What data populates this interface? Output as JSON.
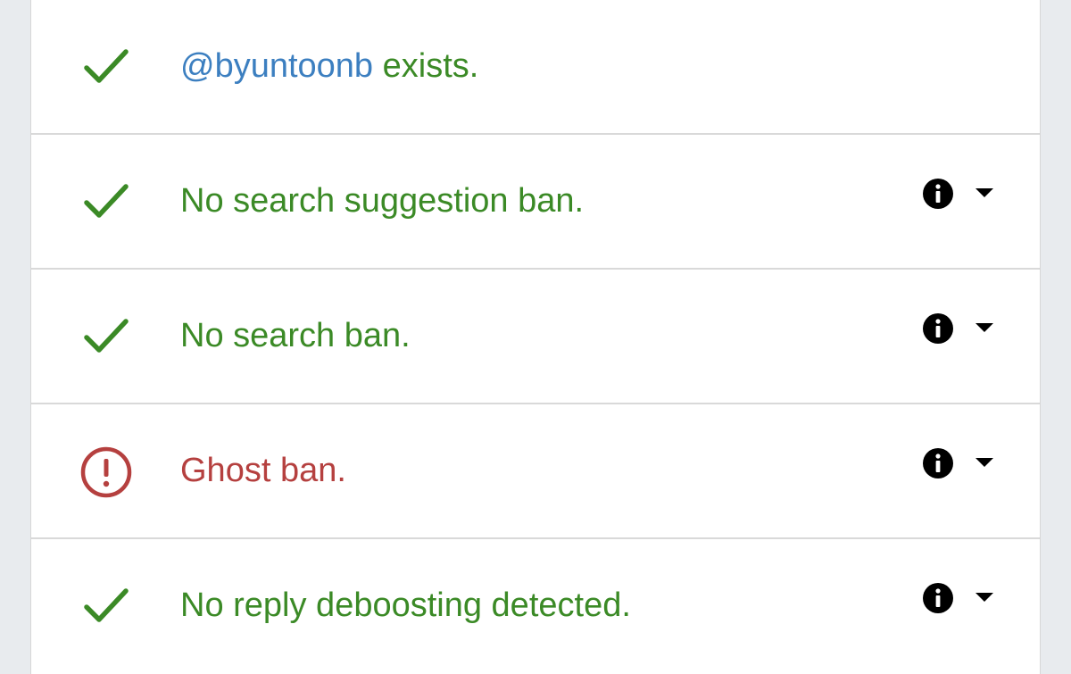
{
  "colors": {
    "ok": "#3b8a26",
    "error": "#b5403f",
    "handle": "#3c7fc0"
  },
  "results": [
    {
      "status": "ok",
      "status_icon": "check-icon",
      "handle": "@byuntoonb",
      "text": " exists.",
      "has_details": false
    },
    {
      "status": "ok",
      "status_icon": "check-icon",
      "text": "No search suggestion ban.",
      "has_details": true
    },
    {
      "status": "ok",
      "status_icon": "check-icon",
      "text": "No search ban.",
      "has_details": true
    },
    {
      "status": "error",
      "status_icon": "exclamation-circle-icon",
      "text": "Ghost ban.",
      "has_details": true
    },
    {
      "status": "ok",
      "status_icon": "check-icon",
      "text": "No reply deboosting detected.",
      "has_details": true
    }
  ]
}
